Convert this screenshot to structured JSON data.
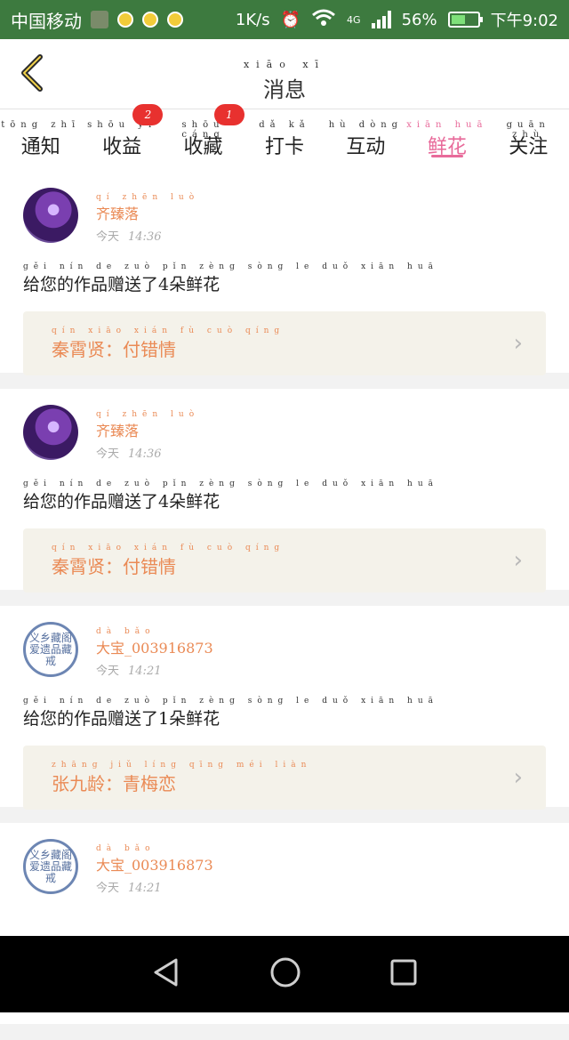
{
  "status_bar": {
    "carrier": "中国移动",
    "speed": "1K/s",
    "network": "4G",
    "battery_percent": "56%",
    "battery_level": 0.56,
    "time": "下午9:02"
  },
  "header": {
    "title": "消息",
    "title_pinyin": "xiāo xī",
    "back_icon": "chevron-left-icon"
  },
  "tabs": [
    {
      "label": "通知",
      "pinyin": "tōng zhī",
      "badge": ""
    },
    {
      "label": "收益",
      "pinyin": "shōu yì",
      "badge": "2"
    },
    {
      "label": "收藏",
      "pinyin": "shōu cáng",
      "badge": "1"
    },
    {
      "label": "打卡",
      "pinyin": "dǎ kǎ",
      "badge": ""
    },
    {
      "label": "互动",
      "pinyin": "hù dòng",
      "badge": ""
    },
    {
      "label": "鲜花",
      "pinyin": "xiān huā",
      "badge": "",
      "active": true
    },
    {
      "label": "关注",
      "pinyin": "guān zhù",
      "badge": ""
    }
  ],
  "items": [
    {
      "user": "齐臻落",
      "user_pinyin": "qí zhēn luò",
      "meta": "今天",
      "time": "14:36",
      "message": "给您的作品赠送了4朵鲜花",
      "message_pinyin": "gěi nín de zuò pǐn zèng sòng le duǒ xiān huā",
      "work": "秦霄贤：付错情",
      "work_pinyin": "qín xiāo xián fù cuò qíng",
      "avatar": "anime"
    },
    {
      "user": "齐臻落",
      "user_pinyin": "qí zhēn luò",
      "meta": "今天",
      "time": "14:36",
      "message": "给您的作品赠送了4朵鲜花",
      "message_pinyin": "gěi nín de zuò pǐn zèng sòng le duǒ xiān huā",
      "work": "秦霄贤：付错情",
      "work_pinyin": "qín xiāo xián fù cuò qíng",
      "avatar": "anime"
    },
    {
      "user": "大宝_003916873",
      "user_pinyin": "dà bǎo",
      "meta": "今天",
      "time": "14:21",
      "message": "给您的作品赠送了1朵鲜花",
      "message_pinyin": "gěi nín de zuò pǐn zèng sòng le duǒ xiān huā",
      "work": "张九龄：青梅恋",
      "work_pinyin": "zhāng jiǔ líng qīng méi liàn",
      "avatar": "seal"
    },
    {
      "user": "大宝_003916873",
      "user_pinyin": "dà bǎo",
      "meta": "今天",
      "time": "14:21",
      "message": "",
      "message_pinyin": "",
      "work": "",
      "work_pinyin": "",
      "avatar": "seal"
    }
  ],
  "seal_text": "义乡藏阁 爱遗品藏 戒",
  "colors": {
    "accent": "#e86a9a",
    "name": "#ea8a55",
    "status_bar": "#3d7a3f",
    "badge": "#e8312f"
  }
}
